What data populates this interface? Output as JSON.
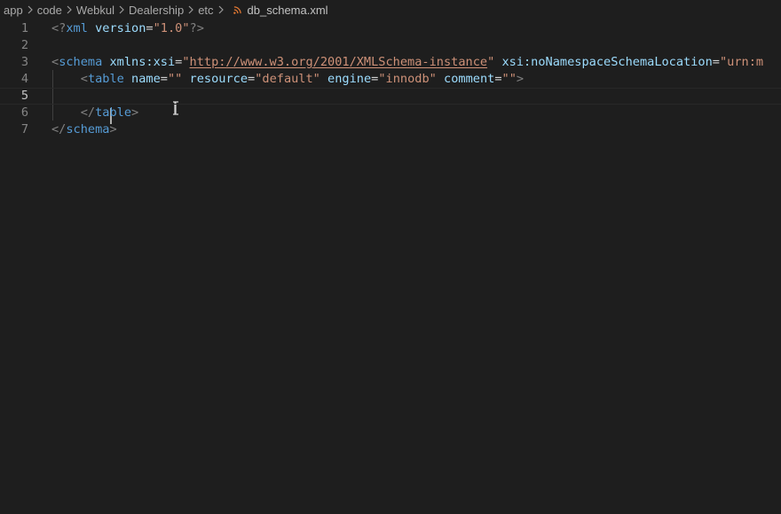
{
  "breadcrumb": {
    "items": [
      "app",
      "code",
      "Webkul",
      "Dealership",
      "etc"
    ],
    "file": "db_schema.xml",
    "file_icon": "rss-icon"
  },
  "editor": {
    "active_line": 5,
    "lines": [
      {
        "number": "1",
        "tokens": [
          {
            "t": "<?",
            "c": "t-punct"
          },
          {
            "t": "xml",
            "c": "t-tag"
          },
          {
            "t": " version",
            "c": "t-attr"
          },
          {
            "t": "=",
            "c": "t-eq"
          },
          {
            "t": "\"1.0\"",
            "c": "t-str"
          },
          {
            "t": "?>",
            "c": "t-punct"
          }
        ]
      },
      {
        "number": "2",
        "tokens": []
      },
      {
        "number": "3",
        "tokens": [
          {
            "t": "<",
            "c": "t-punct"
          },
          {
            "t": "schema",
            "c": "t-tag"
          },
          {
            "t": " xmlns:xsi",
            "c": "t-attr"
          },
          {
            "t": "=",
            "c": "t-eq"
          },
          {
            "t": "\"",
            "c": "t-str"
          },
          {
            "t": "http://www.w3.org/2001/XMLSchema-instance",
            "c": "t-link"
          },
          {
            "t": "\"",
            "c": "t-str"
          },
          {
            "t": " xsi:noNamespaceSchemaLocation",
            "c": "t-attr"
          },
          {
            "t": "=",
            "c": "t-eq"
          },
          {
            "t": "\"urn:m",
            "c": "t-str"
          }
        ]
      },
      {
        "number": "4",
        "tokens": [
          {
            "t": "    ",
            "c": ""
          },
          {
            "t": "<",
            "c": "t-punct"
          },
          {
            "t": "table",
            "c": "t-tag"
          },
          {
            "t": " name",
            "c": "t-attr"
          },
          {
            "t": "=",
            "c": "t-eq"
          },
          {
            "t": "\"\"",
            "c": "t-str"
          },
          {
            "t": " resource",
            "c": "t-attr"
          },
          {
            "t": "=",
            "c": "t-eq"
          },
          {
            "t": "\"default\"",
            "c": "t-str"
          },
          {
            "t": " engine",
            "c": "t-attr"
          },
          {
            "t": "=",
            "c": "t-eq"
          },
          {
            "t": "\"innodb\"",
            "c": "t-str"
          },
          {
            "t": " comment",
            "c": "t-attr"
          },
          {
            "t": "=",
            "c": "t-eq"
          },
          {
            "t": "\"\"",
            "c": "t-str"
          },
          {
            "t": ">",
            "c": "t-punct"
          }
        ]
      },
      {
        "number": "5",
        "tokens": []
      },
      {
        "number": "6",
        "tokens": [
          {
            "t": "    ",
            "c": ""
          },
          {
            "t": "</",
            "c": "t-punct"
          },
          {
            "t": "table",
            "c": "t-tag"
          },
          {
            "t": ">",
            "c": "t-punct"
          }
        ]
      },
      {
        "number": "7",
        "tokens": [
          {
            "t": "</",
            "c": "t-punct"
          },
          {
            "t": "schema",
            "c": "t-tag"
          },
          {
            "t": ">",
            "c": "t-punct"
          }
        ]
      }
    ]
  }
}
